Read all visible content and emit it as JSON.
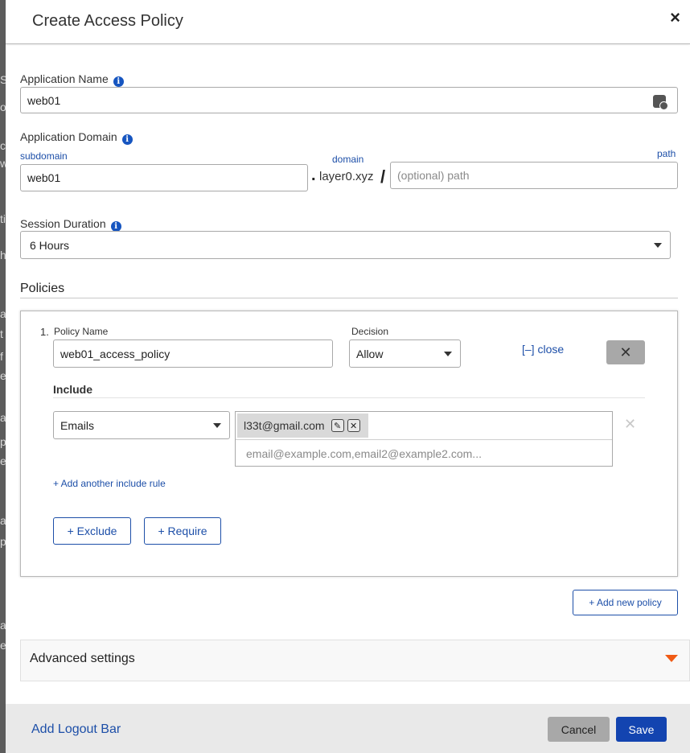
{
  "backdrop": {
    "fragments": [
      "S",
      "ol",
      "ct",
      "w",
      "ti",
      "h",
      "a",
      "t",
      "f",
      "e",
      "a",
      "p",
      "e",
      "a",
      "p",
      "a",
      "e"
    ]
  },
  "modal": {
    "title": "Create Access Policy",
    "close_icon": "×"
  },
  "app_name": {
    "label": "Application Name",
    "value": "web01",
    "icon": "contact-card-icon"
  },
  "app_domain": {
    "label": "Application Domain",
    "subdomain_label": "subdomain",
    "subdomain_value": "web01",
    "separator_dot": ".",
    "domain_label": "domain",
    "domain_value": "layer0.xyz",
    "separator_slash": "/",
    "path_label": "path",
    "path_placeholder": "(optional) path"
  },
  "session": {
    "label": "Session Duration",
    "value": "6 Hours"
  },
  "policies": {
    "title": "Policies",
    "items": [
      {
        "index": "1.",
        "name_label": "Policy Name",
        "name_value": "web01_access_policy",
        "decision_label": "Decision",
        "decision_value": "Allow",
        "collapse_label": "[–] close",
        "remove_icon": "✕",
        "include": {
          "title": "Include",
          "rule_type": "Emails",
          "tags": [
            "l33t@gmail.com"
          ],
          "email_placeholder": "email@example.com,email2@example2.com...",
          "remove_rule_icon": "✕",
          "add_rule_label": "+ Add another include rule"
        },
        "exclude_label": "+ Exclude",
        "require_label": "+ Require"
      }
    ],
    "add_policy_label": "+ Add new policy"
  },
  "advanced": {
    "title": "Advanced settings"
  },
  "footer": {
    "logout_label": "Add Logout Bar",
    "cancel_label": "Cancel",
    "save_label": "Save"
  },
  "colors": {
    "accent": "#1d4fa8",
    "primary_button": "#1344b0",
    "caret_orange": "#f05a14",
    "info_blue": "#1655c0"
  }
}
